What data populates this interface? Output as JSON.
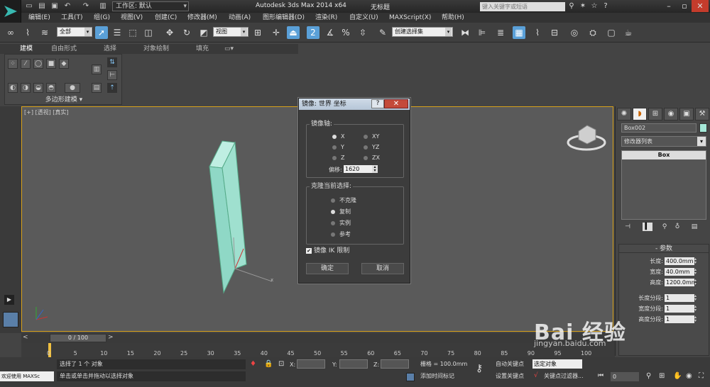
{
  "app": {
    "title": "Autodesk 3ds Max  2014 x64",
    "document": "无标题",
    "workspace_label": "工作区: 默认",
    "search_placeholder": "键入关键字或短语"
  },
  "menu": [
    "编辑(E)",
    "工具(T)",
    "组(G)",
    "视图(V)",
    "创建(C)",
    "修改器(M)",
    "动画(A)",
    "图形编辑器(D)",
    "渲染(R)",
    "自定义(U)",
    "MAXScript(X)",
    "帮助(H)"
  ],
  "toolbar": {
    "selection_filter": "全部",
    "reference_coord": "视图",
    "named_selection": "创建选择集"
  },
  "ribbon": {
    "tabs": [
      "建模",
      "自由形式",
      "选择",
      "对象绘制",
      "填充"
    ],
    "panel_label": "多边形建模"
  },
  "viewport": {
    "label_plus": "[+]",
    "label_view": "[透视]",
    "label_shade": "[真实]"
  },
  "dialog": {
    "title": "镜像: 世界 坐标",
    "help": "?",
    "close": "✕",
    "axis_group": "镜像轴:",
    "axes": [
      {
        "label": "X",
        "selected": true
      },
      {
        "label": "XY",
        "selected": false
      },
      {
        "label": "Y",
        "selected": false
      },
      {
        "label": "YZ",
        "selected": false
      },
      {
        "label": "Z",
        "selected": false
      },
      {
        "label": "ZX",
        "selected": false
      }
    ],
    "offset_label": "偏移:",
    "offset_value": "1620",
    "clone_group": "克隆当前选择:",
    "clone_options": [
      {
        "label": "不克隆",
        "selected": false
      },
      {
        "label": "复制",
        "selected": true
      },
      {
        "label": "实例",
        "selected": false
      },
      {
        "label": "参考",
        "selected": false
      }
    ],
    "ik_label": "镜像 IK 限制",
    "ik_checked": true,
    "ok": "确定",
    "cancel": "取消"
  },
  "command_panel": {
    "object_name": "Box002",
    "object_color": "#a5e8d8",
    "modifier_list": "修改器列表",
    "stack_item": "Box",
    "rollout_title": "参数",
    "params": [
      {
        "label": "长度:",
        "value": "400.0mm"
      },
      {
        "label": "宽度:",
        "value": "40.0mm"
      },
      {
        "label": "高度:",
        "value": "1200.0mm"
      }
    ],
    "segments": [
      {
        "label": "长度分段:",
        "value": "1"
      },
      {
        "label": "宽度分段:",
        "value": "1"
      },
      {
        "label": "高度分段:",
        "value": "1"
      }
    ]
  },
  "timeline": {
    "slider": "0 / 100",
    "ticks": [
      "0",
      "5",
      "10",
      "15",
      "20",
      "25",
      "30",
      "35",
      "40",
      "45",
      "50",
      "55",
      "60",
      "65",
      "70",
      "75",
      "80",
      "85",
      "90",
      "95",
      "100"
    ]
  },
  "status": {
    "welcome": "欢迎使用 MAXSc",
    "line1": "选择了 1 个 对象",
    "line2": "单击或单击并拖动以选择对象",
    "x_label": "X:",
    "y_label": "Y:",
    "z_label": "Z:",
    "grid": "栅格 = 100.0mm",
    "add_time_tag": "添加时间标记",
    "auto_key": "自动关键点",
    "set_key": "设置关键点",
    "selected": "选定对象",
    "key_filters": "关键点过滤器...",
    "frame": "0"
  },
  "watermark": {
    "text": "Bai 经验",
    "sub": "jingyan.baidu.com"
  }
}
